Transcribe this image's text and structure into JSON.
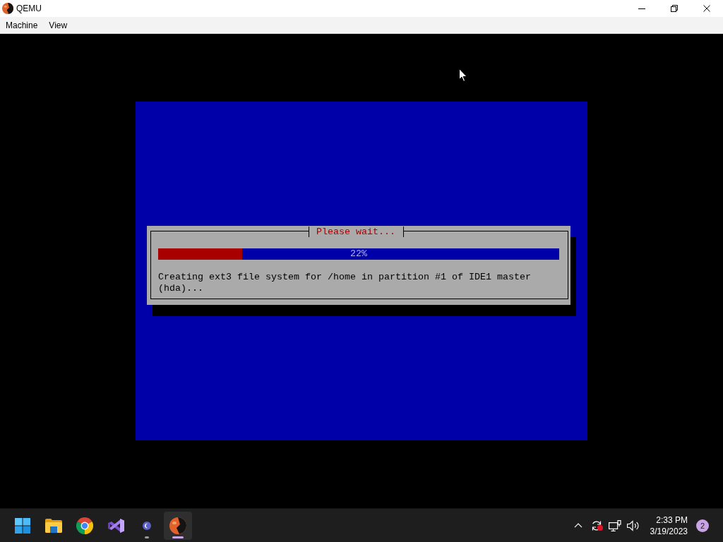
{
  "window": {
    "title": "QEMU"
  },
  "menu": [
    {
      "label": "Machine"
    },
    {
      "label": "View"
    }
  ],
  "installer": {
    "dialog": {
      "title": "Please wait...",
      "progress": {
        "level": 0.21,
        "reading": "22%"
      },
      "message": "Creating ext3 file system for /home in partition #1 of IDE1 master (hda)..."
    }
  },
  "taskbar": {
    "apps": [
      {
        "kind": "start",
        "running": false,
        "selected": false
      },
      {
        "kind": "folder",
        "running": false,
        "selected": false
      },
      {
        "kind": "browser",
        "running": false,
        "selected": false
      },
      {
        "kind": "ide",
        "running": false,
        "selected": false
      },
      {
        "kind": "chat",
        "running": true,
        "selected": false
      },
      {
        "kind": "emulator",
        "running": true,
        "selected": true
      }
    ],
    "clock": {
      "time": "2:33 PM",
      "date": "3/19/2023"
    },
    "notifications": "2"
  }
}
